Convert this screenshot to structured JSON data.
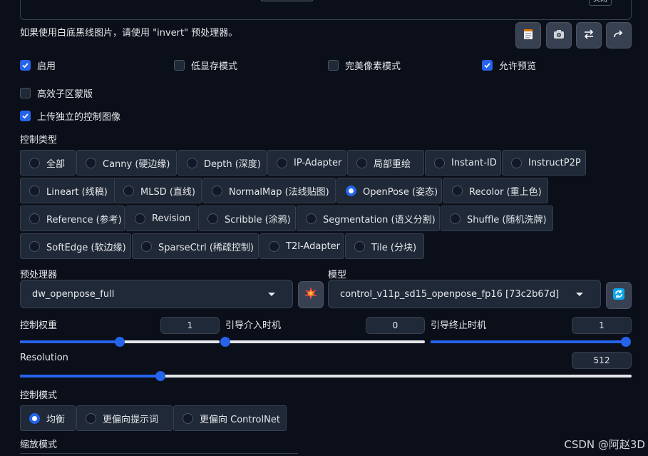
{
  "top": {
    "close_label": "关闭"
  },
  "hint": "如果使用白底黑线图片，请使用 \"invert\" 预处理器。",
  "toolbar": {
    "buttons": [
      {
        "icon": "notepad-icon"
      },
      {
        "icon": "camera-icon"
      },
      {
        "icon": "swap-icon"
      },
      {
        "icon": "send-icon"
      }
    ]
  },
  "options": {
    "enable": {
      "label": "启用",
      "checked": true
    },
    "low_vram": {
      "label": "低显存模式",
      "checked": false
    },
    "pixel_perfect": {
      "label": "完美像素模式",
      "checked": false
    },
    "allow_preview": {
      "label": "允许预览",
      "checked": true
    },
    "effective_region_mask": {
      "label": "高效子区蒙版",
      "checked": false
    },
    "upload_independent_image": {
      "label": "上传独立的控制图像",
      "checked": true
    }
  },
  "control_type": {
    "label": "控制类型",
    "items": [
      "全部",
      "Canny (硬边缘)",
      "Depth (深度)",
      "IP-Adapter",
      "局部重绘",
      "Instant-ID",
      "InstructP2P",
      "Lineart (线稿)",
      "MLSD (直线)",
      "NormalMap (法线贴图)",
      "OpenPose (姿态)",
      "Recolor (重上色)",
      "Reference (参考)",
      "Revision",
      "Scribble (涂鸦)",
      "Segmentation (语义分割)",
      "Shuffle (随机洗牌)",
      "SoftEdge (软边缘)",
      "SparseCtrl (稀疏控制)",
      "T2I-Adapter",
      "Tile (分块)"
    ],
    "selected": "OpenPose (姿态)"
  },
  "preprocessor": {
    "label": "预处理器",
    "value": "dw_openpose_full",
    "run_icon": "explosion-icon"
  },
  "model": {
    "label": "模型",
    "value": "control_v11p_sd15_openpose_fp16 [73c2b67d]",
    "refresh_icon": "refresh-icon"
  },
  "sliders": {
    "control_weight": {
      "label": "控制权重",
      "value": "1",
      "fraction": 0.5
    },
    "starting_step": {
      "label": "引导介入时机",
      "value": "0",
      "fraction": 0.0
    },
    "ending_step": {
      "label": "引导终止时机",
      "value": "1",
      "fraction": 1.0
    },
    "resolution": {
      "label": "Resolution",
      "value": "512",
      "fraction": 0.23
    }
  },
  "control_mode": {
    "label": "控制模式",
    "items": [
      "均衡",
      "更偏向提示词",
      "更偏向 ControlNet"
    ],
    "selected": "均衡"
  },
  "resize_mode": {
    "label": "缩放模式"
  },
  "watermark": "CSDN @阿赵3D",
  "colors": {
    "accent": "#2563eb",
    "background": "#0b0f19",
    "panel": "#1f2937",
    "border": "#374151"
  }
}
